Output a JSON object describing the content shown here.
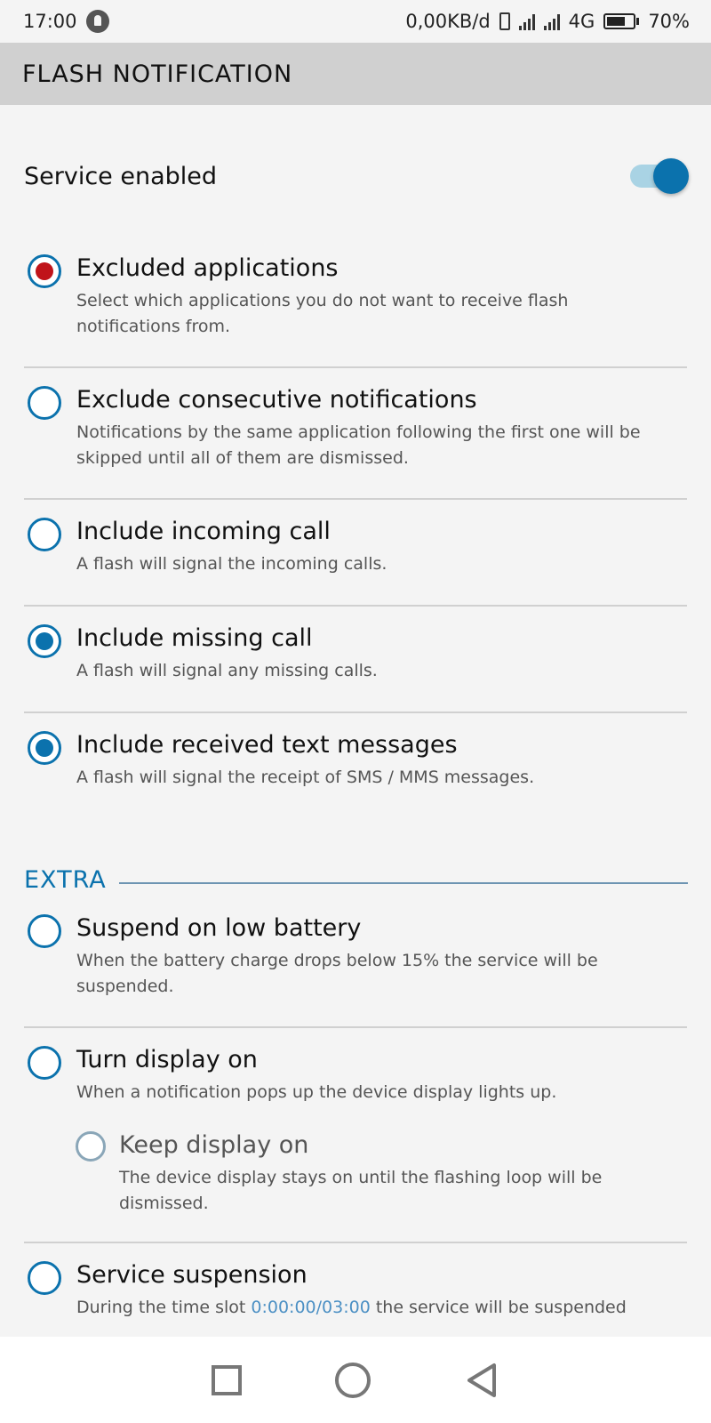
{
  "status": {
    "time": "17:00",
    "network_speed": "0,00KB/d",
    "network_type": "4G",
    "battery": "70%",
    "battery_level": 0.7
  },
  "header": {
    "title": "FLASH NOTIFICATION"
  },
  "service": {
    "label": "Service enabled",
    "enabled": true
  },
  "options": [
    {
      "title": "Excluded applications",
      "desc": "Select which applications you do not want to receive flash notifications from.",
      "checked": true
    },
    {
      "title": "Exclude consecutive notifications",
      "desc": "Notifications by the same application following the first one will be skipped until all of them are dismissed.",
      "checked": false
    },
    {
      "title": "Include incoming call",
      "desc": "A flash will signal the incoming calls.",
      "checked": false
    },
    {
      "title": "Include missing call",
      "desc": "A flash will signal any missing calls.",
      "checked": true
    },
    {
      "title": "Include received text messages",
      "desc": "A flash will signal the receipt of SMS / MMS messages.",
      "checked": true
    }
  ],
  "extra": {
    "section_title": "EXTRA",
    "options": [
      {
        "title": "Suspend on low battery",
        "desc": "When the battery charge drops below 15% the service will be suspended.",
        "checked": false
      },
      {
        "title": "Turn display on",
        "desc": "When a notification pops up the device display lights up.",
        "checked": false
      },
      {
        "title": "Keep display on",
        "desc": "The device display stays on until the flashing loop will be dismissed.",
        "checked": false
      },
      {
        "title": "Service suspension",
        "desc_before": "During the time slot ",
        "desc_link": "0:00:00/03:00",
        "desc_after": " the service will be suspended",
        "checked": false
      }
    ]
  }
}
